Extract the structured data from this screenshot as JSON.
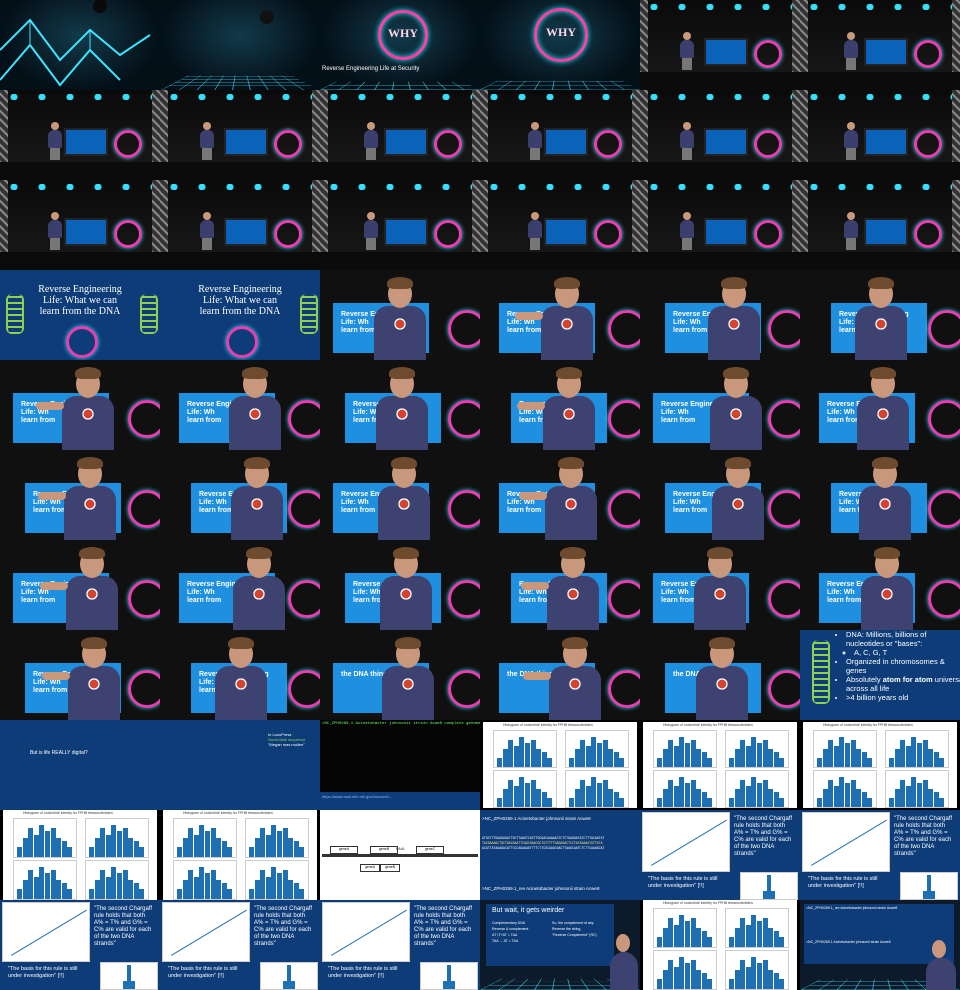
{
  "window": {
    "title": ""
  },
  "intro": {
    "logo_text": "WHY",
    "subtitle": "Reverse Engineering Life at Security"
  },
  "title_slide": {
    "title_line1": "Reverse Engineering",
    "title_line2": "Life: What we can",
    "title_line3": "learn from the DNA",
    "badge": "DNA"
  },
  "closeup_screen_text": {
    "line1": "Reverse Engineering",
    "line2": "Life: Wh",
    "line3": "learn from",
    "short": "Reverse",
    "dna_things": "the DNA things"
  },
  "dna_facts": {
    "b1": "DNA: Millions, billions of nucleotides or \"bases\":",
    "b1a": "A, C, G, T",
    "b2": "Organized in chromosomes & genes",
    "b3_pre": "Absolutely ",
    "b3_bold": "atom for atom",
    "b3_post": " universal across all life",
    "b4": ">4 billion years old"
  },
  "digital_slide": {
    "question": "But is life REALLY digital?",
    "sidebar_header": "In LuxoPress",
    "sidebar_green": "Nucleotide sequence",
    "sidebar_note": "\"Megan mas mullen\""
  },
  "chargaff": {
    "quote": "\"The second Chargaff rule holds that both A% = T% and G% = C% are valid for each of the two DNA strands\"",
    "quote_l1": "\"The second Chargaff",
    "quote_l2": "rule holds that both",
    "quote_l3": "A% = T% and G% =",
    "quote_l4": "C% are valid for each",
    "quote_l5": "of the two DNA",
    "quote_l6": "strands\"",
    "basis": "\"The basis for this rule is still under investigation\" [!!]",
    "basis_l1": "\"The basis for this rule is still",
    "basis_l2": "under investigation\" [!!]",
    "hist_title": "Histogram of nucleotide identity for FPHB tetranucleotides"
  },
  "genome": {
    "header1": ">NC_ZPH0269.1 Acinetobacter johnsonii strain Acwe8",
    "header2": ">NC_ZPH0269.1_rev Acinetobacter johnsonii strain Acwe8",
    "seq1": "ATGCTTTGAAGAGATTGCTTAAGTCGCTTGCGACAAAAACTCTCTGAGGATATCTTTACAATAT",
    "seq2": "TACGAAAGCTGCTAACGAATTCAGCGAACGCTGTTTTTGAGAGACTCCTATAGAAATGTTATA",
    "seq3": "ACATTATAAAGACATTCCCAGAGAGTTTTCTTCGCAAGCGACTTAAGCAATCTCTTCAAAGCAT"
  },
  "weirder": {
    "title": "But wait, it gets weirder",
    "item1": "Complementary DNA",
    "item2": "Reverse & complement",
    "item3": "AT∖T+AT = TAA",
    "item4": "TAA → AT = TAA",
    "right1": "So, the complement of any",
    "right2": "Reverse the string",
    "right3": "\"Reverse Complement\" (RC)"
  },
  "terminal": {
    "line1": ">NC_ZPH0269.1 Acinetobacter johnsonii strain Acwe8 complete genome",
    "url": "https://www.ncbi.nlm.nih.gov/nuccore/..."
  },
  "gene_diagram": {
    "gene_a": "geneA",
    "gene_b": "geneB",
    "gene_c": "geneC",
    "axis": "DNA"
  },
  "chart_data": {
    "type": "bar",
    "title": "Histogram of nucleotide identity for FPHB tetranucleotides",
    "panels": 4,
    "values": [
      3,
      6,
      9,
      7,
      10,
      8,
      9,
      6,
      5,
      3
    ]
  },
  "colors": {
    "slide_blue": "#0d3c78",
    "neon_cyan": "#34e0ff",
    "neon_pink": "#ff3fa4",
    "bar_blue": "#1f6fb3"
  }
}
